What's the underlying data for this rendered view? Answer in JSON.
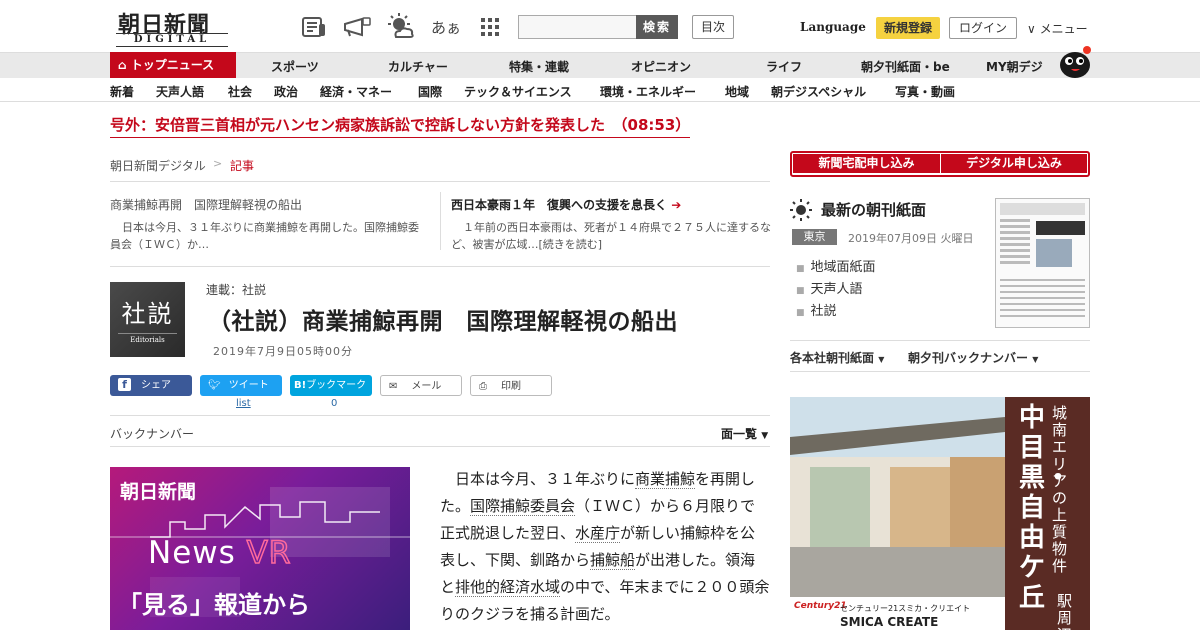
{
  "header": {
    "logo_title": "朝日新聞",
    "logo_sub": "DIGITAL",
    "icons": [
      "newspaper-icon",
      "megaphone-icon",
      "weather-icon",
      "font-size-icon",
      "grid-icon"
    ],
    "font_icon_text": "あぁ",
    "search_placeholder": "",
    "search_label": "検索",
    "index_label": "目次",
    "language_label": "Language",
    "register_label": "新規登録",
    "login_label": "ログイン",
    "menu_label": "メニュー"
  },
  "nav_primary": {
    "top_news": "トップニュース",
    "items": [
      "スポーツ",
      "カルチャー",
      "特集・連載",
      "オピニオン",
      "ライフ",
      "朝夕刊紙面・be",
      "MY朝デジ"
    ]
  },
  "nav_secondary": {
    "items": [
      "新着",
      "天声人語",
      "社会",
      "政治",
      "経済・マネー",
      "国際",
      "テック＆サイエンス",
      "環境・エネルギー",
      "地域",
      "朝デジスペシャル",
      "写真・動画"
    ]
  },
  "breaking": "号外：安倍晋三首相が元ハンセン病家族訴訟で控訴しない方針を発表した　（08:53）",
  "breadcrumb": {
    "home": "朝日新聞デジタル",
    "separator": ">",
    "current": "記事"
  },
  "related": [
    {
      "title": "商業捕鯨再開　国際理解軽視の船出",
      "text": "日本は今月、３１年ぶりに商業捕鯨を再開した。国際捕鯨委員会（ＩＷＣ）か…"
    },
    {
      "title": "西日本豪雨１年　復興への支援を息長く",
      "text": "１年前の西日本豪雨は、死者が１４府県で２７５人に達するなど、被害が広域…[続きを読む]"
    }
  ],
  "article": {
    "badge_main": "社説",
    "badge_sub": "Editorials",
    "series": "連載：社説",
    "headline": "（社説）商業捕鯨再開　国際理解軽視の船出",
    "date": "2019年7月9日05時00分",
    "body": [
      {
        "t": "日本は今月、３１年ぶりに",
        "kw": false
      },
      {
        "t": "商業捕鯨",
        "kw": true
      },
      {
        "t": "を再開した。",
        "kw": false
      },
      {
        "t": "国際捕鯨委員会",
        "kw": true
      },
      {
        "t": "（ＩＷＣ）から６月限りで正式脱退した翌日、",
        "kw": false
      },
      {
        "t": "水産庁",
        "kw": true
      },
      {
        "t": "が新しい捕鯨枠を公表し、下関、釧路から",
        "kw": false
      },
      {
        "t": "捕鯨船",
        "kw": true
      },
      {
        "t": "が出港した。領海と",
        "kw": false
      },
      {
        "t": "排他的経済水域",
        "kw": true
      },
      {
        "t": "の中で、年末までに２００頭余りのクジラを捕る計画だ。",
        "kw": false
      }
    ]
  },
  "share": {
    "facebook": "シェア",
    "twitter": "ツイート",
    "twitter_sub": "list",
    "hatena": "ブックマーク",
    "hatena_count": "0",
    "mail": "メール",
    "print": "印刷"
  },
  "backnumber": {
    "label": "バックナンバー",
    "menseki": "面一覧"
  },
  "vr_ad": {
    "brand": "朝日新聞",
    "title_a": "News",
    "title_b": "VR",
    "line1": "「見る」報道から"
  },
  "sidebar": {
    "subscribe_paper": "新聞宅配申し込み",
    "subscribe_digital": "デジタル申し込み",
    "morning_title": "最新の朝刊紙面",
    "region": "東京",
    "paper_date": "2019年07月09日 火曜日",
    "links": [
      "地域面紙面",
      "天声人語",
      "社説"
    ],
    "dropdown_1": "各本社朝刊紙面",
    "dropdown_2": "朝夕刊バックナンバー"
  },
  "home_ad": {
    "tagline": "城南エリアの上質物件",
    "place": "中目黒・自由ケ丘",
    "place_sub": "駅周辺",
    "company_jp": "センチュリー21スミカ・クリエイト",
    "company_en": "SMICA CREATE",
    "brand": "Century21"
  },
  "colors": {
    "brand_red": "#c4081b",
    "register_yellow": "#f5d240",
    "facebook": "#3b5998",
    "twitter": "#1da1f2",
    "hatena": "#00a4de"
  }
}
